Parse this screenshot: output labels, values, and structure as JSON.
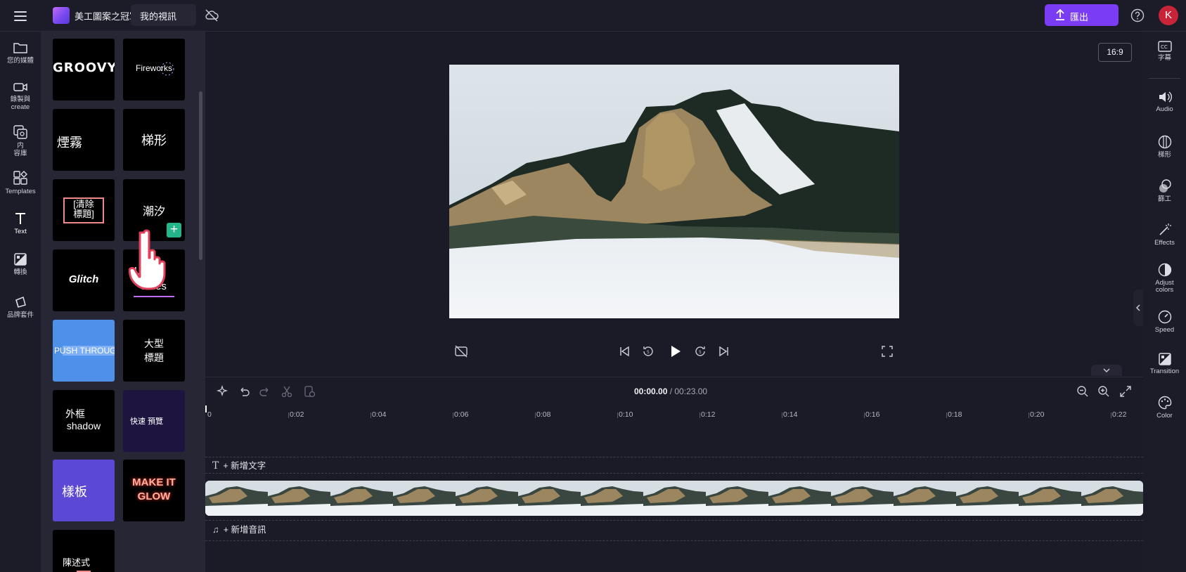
{
  "header": {
    "project_name": "美工圖案之冠軍",
    "title_value": "我的視訊",
    "export_label": "匯出",
    "avatar_initial": "K",
    "accent": "#7a3cf5"
  },
  "left_nav": [
    {
      "label": "您的媒體",
      "icon": "folder-icon"
    },
    {
      "label": "錄製與",
      "label2": "create",
      "icon": "camera-icon"
    },
    {
      "label": "内",
      "label2": "容庫",
      "icon": "content-library-icon"
    },
    {
      "label": "Templates",
      "icon": "templates-icon"
    },
    {
      "label": "Text",
      "icon": "text-icon"
    },
    {
      "label": "轉換",
      "icon": "transitions-icon"
    },
    {
      "label": "品牌套件",
      "icon": "brand-kit-icon"
    }
  ],
  "text_tiles": {
    "groovy": "GROOVY",
    "fireworks": "Fireworks",
    "smoke": "煙霧",
    "trapezoid": "梯形",
    "clear_title_1": "[清除",
    "clear_title_2": "標題]",
    "tide": "潮汐",
    "glitch": "Glitch",
    "lines_1": "L",
    "lines_2": "Lines",
    "push_through": "PUSH THROUGH",
    "large_title_1": "大型",
    "large_title_2": "標題",
    "outline_1": "外框",
    "outline_2": "shadow",
    "quick_preview": "快速 預覽",
    "template": "樣板",
    "make_it_glow_1": "MAKE IT",
    "make_it_glow_2": "GLOW",
    "statement": "陳述式"
  },
  "preview": {
    "aspect_ratio": "16:9"
  },
  "timeline": {
    "current_time": "00:00.00",
    "total_time": "/ 00:23.00",
    "ticks": [
      "0",
      "0:02",
      "0:04",
      "0:06",
      "0:08",
      "0:10",
      "0:12",
      "0:14",
      "0:16",
      "0:18",
      "0:20",
      "0:22"
    ],
    "add_text": "+ 新增文字",
    "add_audio": "+ 新增音訊"
  },
  "right_nav": [
    {
      "label": "字幕",
      "icon": "captions-icon"
    },
    {
      "label": "Audio",
      "icon": "audio-icon"
    },
    {
      "label": "梯形",
      "icon": "fade-icon"
    },
    {
      "label": "篩工",
      "icon": "filters-icon"
    },
    {
      "label": "Effects",
      "icon": "effects-icon"
    },
    {
      "label": "Adjust",
      "label2": "colors",
      "icon": "adjust-colors-icon"
    },
    {
      "label": "Speed",
      "icon": "speed-icon"
    },
    {
      "label": "Transition",
      "icon": "transition-icon"
    },
    {
      "label": "Color",
      "icon": "color-icon"
    }
  ]
}
